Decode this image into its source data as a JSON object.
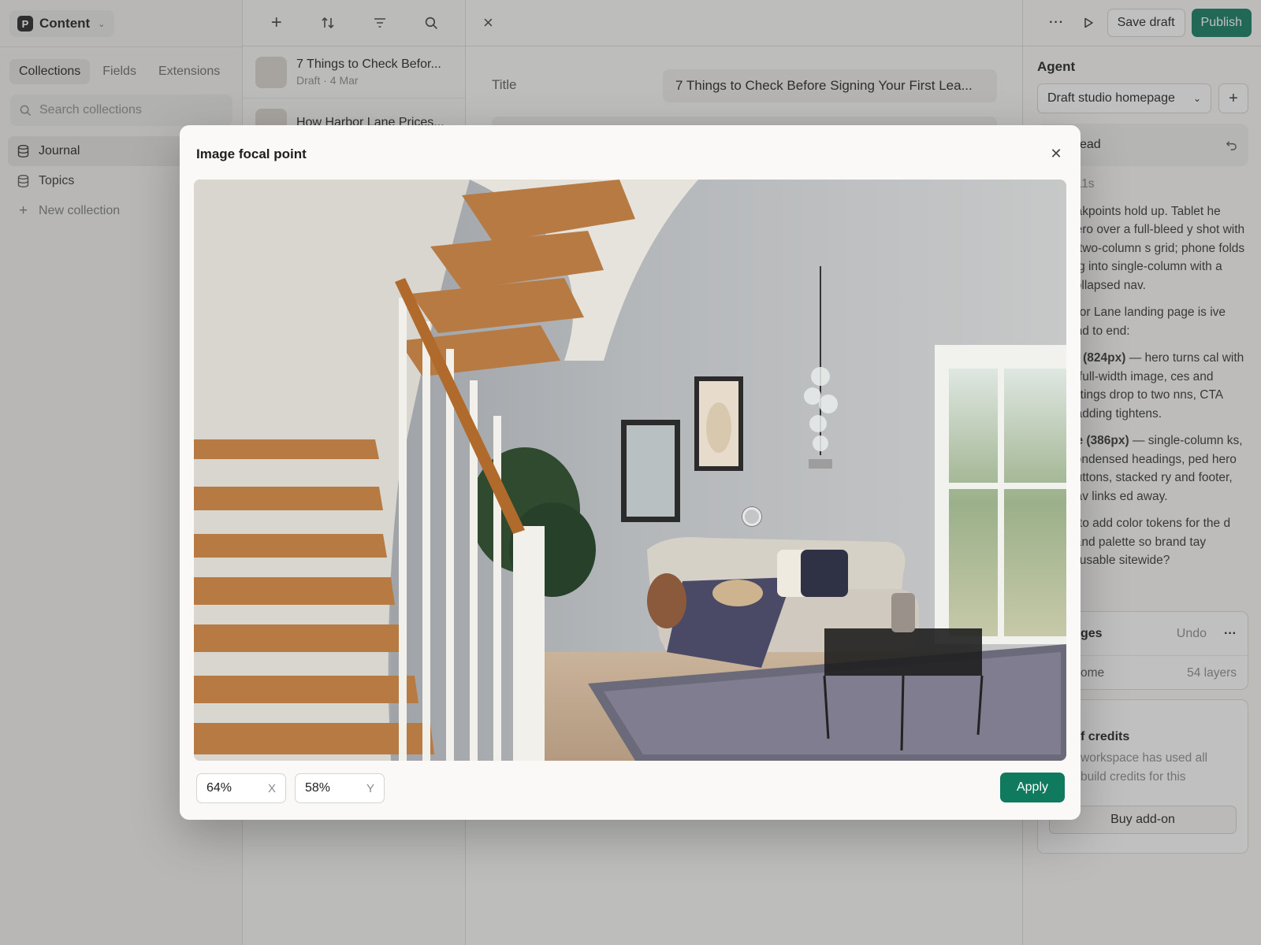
{
  "workspace": {
    "logo_letter": "P",
    "name": "Content"
  },
  "sidebar": {
    "tabs": [
      "Collections",
      "Fields",
      "Extensions"
    ],
    "search_placeholder": "Search collections",
    "items": [
      {
        "label": "Journal"
      },
      {
        "label": "Topics"
      }
    ],
    "new_collection": "New collection"
  },
  "list": {
    "rows": [
      {
        "title": "7 Things to Check Befor...",
        "meta": "Draft · 4 Mar"
      },
      {
        "title": "How Harbor Lane Prices...",
        "meta": ""
      }
    ]
  },
  "editor": {
    "title_label": "Title",
    "title_value": "7 Things to Check Before Signing Your First Lea..."
  },
  "agent": {
    "toolbar": {
      "save_draft": "Save draft",
      "publish": "Publish"
    },
    "heading": "Agent",
    "select_value": "Draft studio homepage",
    "thread_label": "ead",
    "meta": "t  11s",
    "paragraphs": [
      "eakpoints hold up. Tablet he hero over a full-bleed y shot with a two-column s grid; phone folds ing into single-column with a collapsed nav.",
      "rbor Lane landing page is ive end to end:",
      "— hero turns cal with a full-width image, ces and listings drop to two nns, CTA padding tightens.",
      "— single-column ks, condensed headings, ped hero buttons, stacked ry and footer, nav links ed away.",
      "e to add color tokens for the d sand palette so brand tay reusable sitewide?"
    ],
    "bold_tablet": "et (824px)",
    "bold_phone": "ne (386px)",
    "changes": {
      "title": "ges",
      "undo": "Undo",
      "item": "ome",
      "count": "54 layers"
    },
    "credits": {
      "title": "f credits",
      "desc": "workspace has used all build credits for this",
      "button": "Buy add-on"
    }
  },
  "modal": {
    "title": "Image focal point",
    "x_value": "64%",
    "x_axis": "X",
    "y_value": "58%",
    "y_axis": "Y",
    "apply": "Apply",
    "focal_x": 0.64,
    "focal_y": 0.58
  },
  "colors": {
    "accent": "#0f7a5e"
  }
}
